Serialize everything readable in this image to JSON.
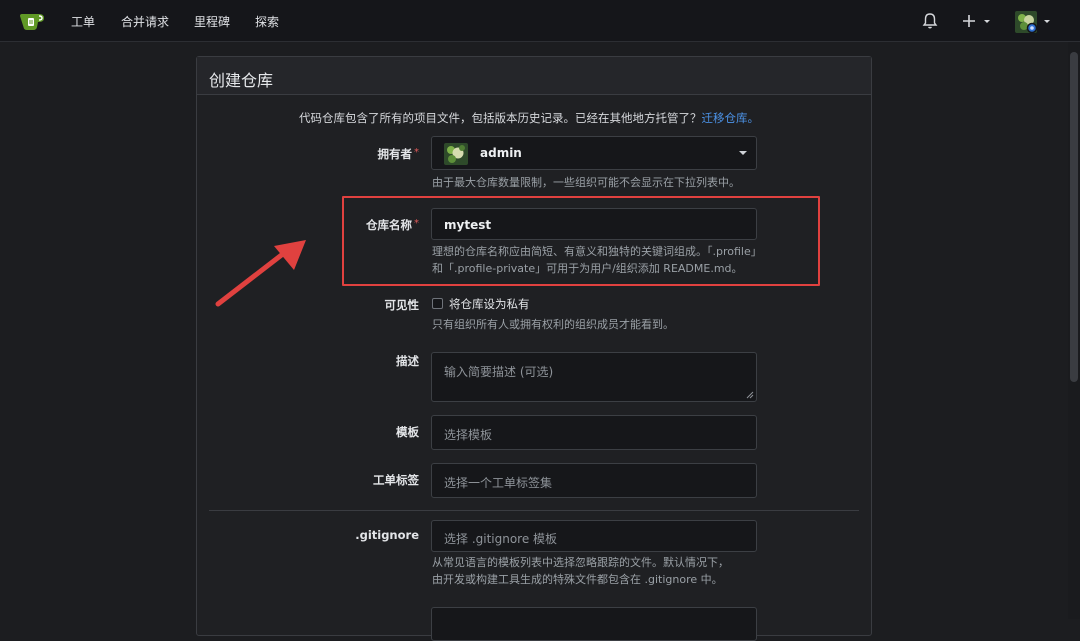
{
  "nav": {
    "items": [
      {
        "label": "工单"
      },
      {
        "label": "合并请求"
      },
      {
        "label": "里程碑"
      },
      {
        "label": "探索"
      }
    ],
    "icons": [
      "gitea-logo-icon",
      "bell-icon",
      "plus-icon",
      "user-avatar"
    ]
  },
  "panel": {
    "title": "创建仓库",
    "intro_text": "代码仓库包含了所有的项目文件，包括版本历史记录。已经在其他地方托管了？",
    "intro_link": "迁移仓库。"
  },
  "form": {
    "owner": {
      "label": "拥有者",
      "value": "admin",
      "help": "由于最大仓库数量限制，一些组织可能不会显示在下拉列表中。"
    },
    "repo_name": {
      "label": "仓库名称",
      "value": "mytest",
      "help_line1": "理想的仓库名称应由简短、有意义和独特的关键词组成。「.profile」",
      "help_line2": "和「.profile-private」可用于为用户/组织添加 README.md。"
    },
    "visibility": {
      "label": "可见性",
      "checkbox_label": "将仓库设为私有",
      "checked": false,
      "help": "只有组织所有人或拥有权利的组织成员才能看到。"
    },
    "description": {
      "label": "描述",
      "placeholder": "输入简要描述 (可选)"
    },
    "template": {
      "label": "模板",
      "placeholder": "选择模板"
    },
    "issue_labels": {
      "label": "工单标签",
      "placeholder": "选择一个工单标签集"
    },
    "gitignore": {
      "label": ".gitignore",
      "placeholder": "选择 .gitignore 模板",
      "help_line1": "从常见语言的模板列表中选择忽略跟踪的文件。默认情况下，",
      "help_line2": "由开发或构建工具生成的特殊文件都包含在 .gitignore 中。"
    },
    "required_mark": "*"
  },
  "colors": {
    "accent_link": "#4c93e8",
    "highlight": "#e0413f",
    "required": "#e05a5a"
  }
}
